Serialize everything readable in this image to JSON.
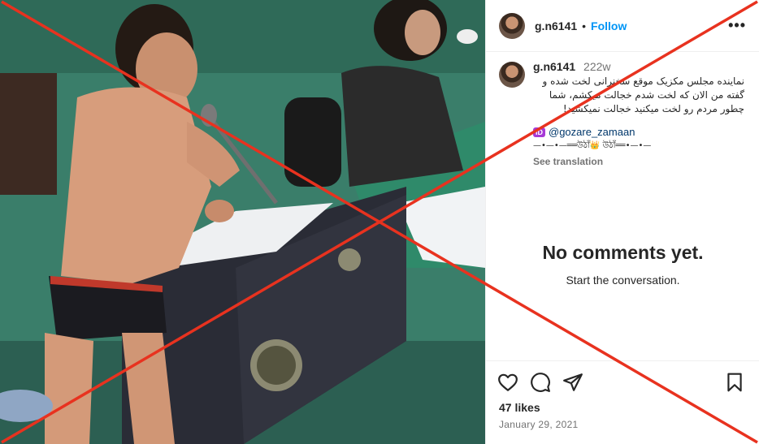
{
  "post": {
    "username": "g.n6141",
    "separator": "•",
    "follow_label": "Follow",
    "more_label": "•••"
  },
  "caption": {
    "username": "g.n6141",
    "age": "222w",
    "text": "نماینده مجلس مکزیک موقع سخنرانی لخت شده و گفته من الان که لخت شدم خجالت میکشم، شما چطور مردم رو لخت میکنید خجالت نمیکشید!",
    "id_badge": "ID",
    "mention": "@gozare_zamaan",
    "decoration": "—•—•—══উঠাঁ👑 উঠাঁ══•—•—",
    "see_translation": "See translation"
  },
  "comments": {
    "empty_title": "No comments yet.",
    "empty_subtitle": "Start the conversation."
  },
  "actions": {
    "like_icon": "heart-icon",
    "comment_icon": "comment-icon",
    "share_icon": "share-icon",
    "save_icon": "bookmark-icon",
    "likes": "47 likes",
    "date": "January 29, 2021"
  },
  "colors": {
    "follow": "#0095f6",
    "overlay_x": "#e8321f",
    "mention": "#00376b"
  }
}
